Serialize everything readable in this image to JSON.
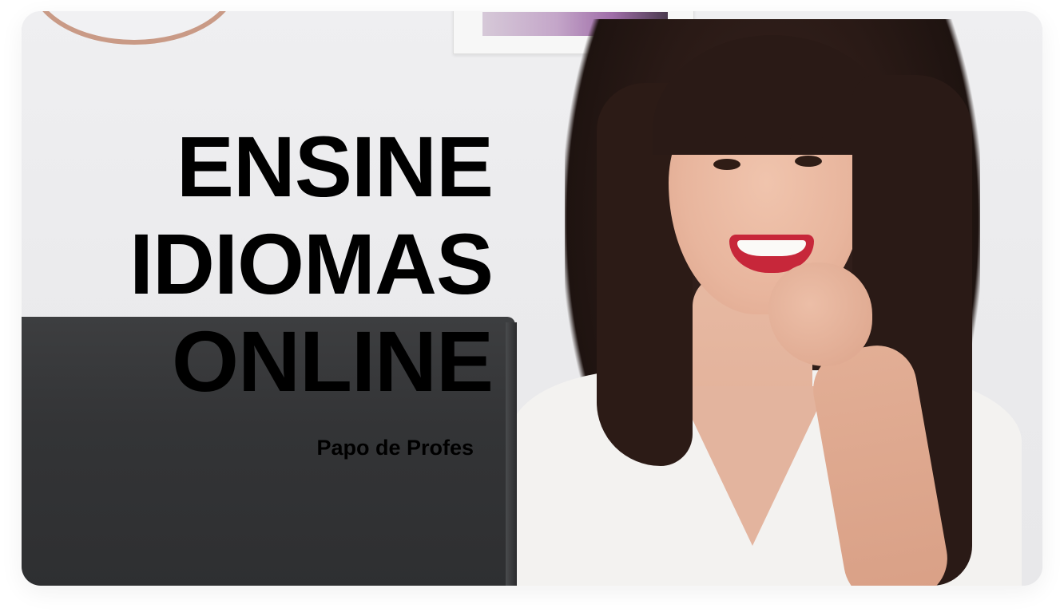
{
  "hero": {
    "headline": {
      "line1": "ENSINE",
      "line2": "IDIOMAS",
      "line3": "ONLINE"
    },
    "subtitle": "Papo de Profes"
  },
  "colors": {
    "text": "#000000",
    "page_background": "#ffffff",
    "lipstick": "#c7273a",
    "shirt": "#f3f2f0",
    "laptop": "#333436"
  }
}
